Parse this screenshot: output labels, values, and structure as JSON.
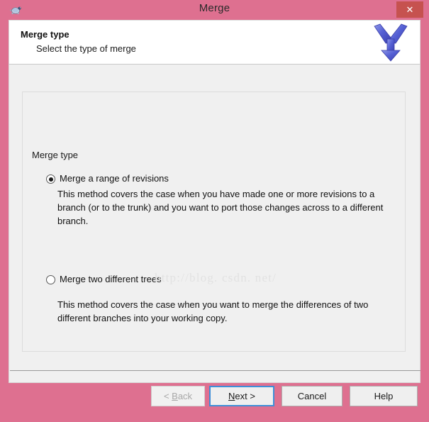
{
  "window": {
    "title": "Merge",
    "icon": "tortoise-icon",
    "close_label": "✕"
  },
  "header": {
    "title": "Merge type",
    "subtitle": "Select the type of merge",
    "icon": "merge-arrow-icon"
  },
  "groupbox": {
    "legend": "Merge type"
  },
  "options": [
    {
      "id": "merge-range-of-revisions",
      "label": "Merge a range of revisions",
      "selected": true,
      "description": "This method covers the case when you have made one or more revisions to a branch (or to the trunk) and you want to port those changes across to a different branch."
    },
    {
      "id": "merge-two-different-trees",
      "label": "Merge two different trees",
      "selected": false,
      "description": "This method covers the case when you want to merge the differences of two different branches into your working copy."
    }
  ],
  "watermark": {
    "text": "http://blog. csdn. net/"
  },
  "buttons": {
    "back": {
      "prefix": "< ",
      "accel": "B",
      "suffix": "ack",
      "enabled": false
    },
    "next": {
      "prefix": "",
      "accel": "N",
      "suffix": "ext >",
      "enabled": true,
      "is_default": true
    },
    "cancel": {
      "label": "Cancel",
      "enabled": true
    },
    "help": {
      "label": "Help",
      "enabled": true
    }
  },
  "colors": {
    "window_chrome": "#de7090",
    "close_button": "#c6524f",
    "panel": "#f0f0f0",
    "header": "#ffffff",
    "focus_border": "#3e8fd8",
    "merge_arrow": "#4a52c8"
  }
}
